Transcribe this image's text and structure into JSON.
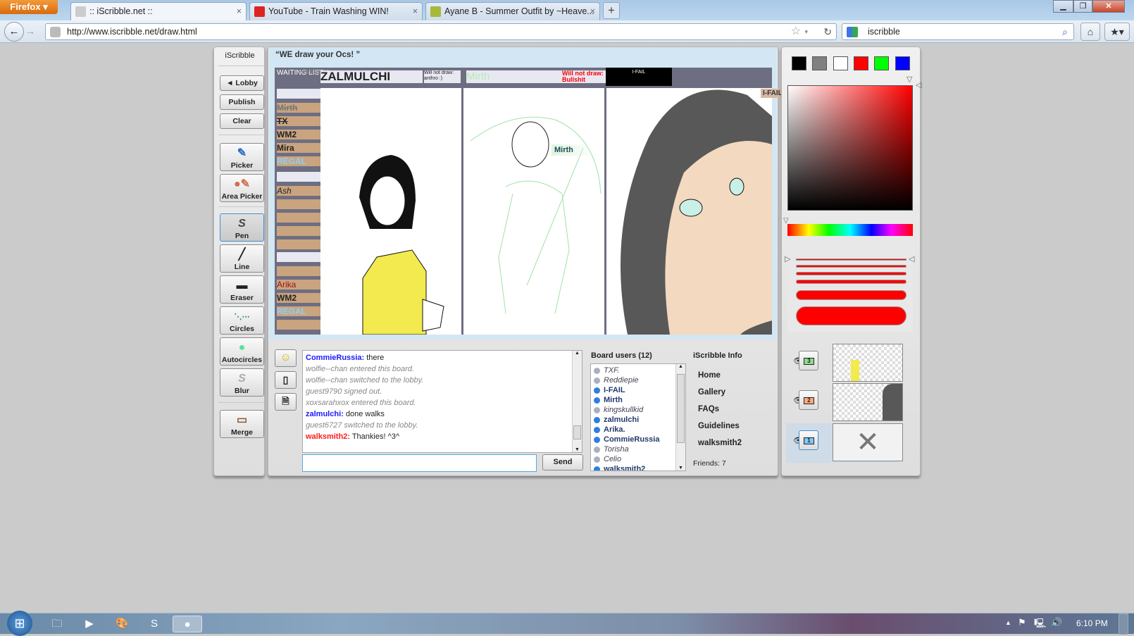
{
  "browser": {
    "menu_button": "Firefox",
    "tabs": [
      {
        "title": ":: iScribble.net ::",
        "active": true
      },
      {
        "title": "YouTube - Train Washing WIN!",
        "active": false
      },
      {
        "title": "Ayane B - Summer Outfit by ~Heave...",
        "active": false
      }
    ],
    "url": "http://www.iscribble.net/draw.html",
    "search_value": "iscribble"
  },
  "toolbar": {
    "brand": "iScribble",
    "lobby": "◄ Lobby",
    "publish": "Publish",
    "clear": "Clear",
    "tools": [
      {
        "label": "Picker",
        "icon": "eyedropper-icon"
      },
      {
        "label": "Area Picker",
        "icon": "area-picker-icon"
      },
      {
        "label": "Pen",
        "icon": "pen-icon",
        "selected": true
      },
      {
        "label": "Line",
        "icon": "line-icon"
      },
      {
        "label": "Eraser",
        "icon": "eraser-icon"
      },
      {
        "label": "Circles",
        "icon": "circles-icon"
      },
      {
        "label": "Autocircles",
        "icon": "autocircles-icon"
      },
      {
        "label": "Blur",
        "icon": "blur-icon"
      },
      {
        "label": "Merge",
        "icon": "merge-icon"
      }
    ]
  },
  "board": {
    "title": "“WE draw your Ocs! ”",
    "canvas": {
      "waiting_list": "WAITING LIST",
      "missing_note": "MISSPINKS",
      "header1": "ZALMULCHI",
      "will_not_draw1": "Will not draw: anthro :)",
      "header2": "Mirth",
      "will_not_draw2": "Will not draw: Bullshit",
      "header3": "I-FAIL",
      "list_entries": [
        "Mirth",
        "TX",
        "WM2",
        "Mira",
        "REGAL",
        "Ash",
        "Arika",
        "WM2",
        "REGAL"
      ],
      "cursor_labels": [
        "Mirth",
        "I-FAIL"
      ]
    }
  },
  "chat": {
    "messages": [
      {
        "user": "CommieRussia:",
        "text": "there",
        "user_color": "#1a1aff"
      },
      {
        "system": "wolfie--chan entered this board."
      },
      {
        "system": "wolfie--chan switched to the lobby."
      },
      {
        "system": "guest9790 signed out."
      },
      {
        "system": "xoxsarahxox entered this board."
      },
      {
        "user": "zalmulchi:",
        "text": "done walks",
        "user_color": "#1a1aff"
      },
      {
        "system": "guest6727 switched to the lobby."
      },
      {
        "user": "walksmith2:",
        "text": "Thankies! ^3^",
        "user_color": "#ff1a1a"
      }
    ],
    "input_value": "",
    "send": "Send"
  },
  "users": {
    "heading": "Board users (12)",
    "list": [
      {
        "name": "TXF.",
        "online": false
      },
      {
        "name": "Reddiepie",
        "online": false
      },
      {
        "name": "I-FAIL",
        "online": true
      },
      {
        "name": "Mirth",
        "online": true
      },
      {
        "name": "kingskullkid",
        "online": false
      },
      {
        "name": "zalmulchi",
        "online": true
      },
      {
        "name": "Arika.",
        "online": true
      },
      {
        "name": "CommieRussia",
        "online": true
      },
      {
        "name": "Torisha",
        "online": false
      },
      {
        "name": "Celio",
        "online": false
      },
      {
        "name": "walksmith2",
        "online": true
      }
    ]
  },
  "info": {
    "heading": "iScribble Info",
    "links": [
      "Home",
      "Gallery",
      "FAQs",
      "Guidelines",
      "walksmith2"
    ],
    "friends": "Friends: 7"
  },
  "palette": {
    "swatches": [
      "#000000",
      "#808080",
      "#ffffff",
      "#ff0000",
      "#00ff00",
      "#0000ff"
    ],
    "current_color": "#ff0000",
    "layers": [
      {
        "number": "3",
        "color": "#8fdc8f",
        "visible": true
      },
      {
        "number": "2",
        "color": "#ffab7a",
        "visible": true
      },
      {
        "number": "1",
        "color": "#7ec8ff",
        "visible": true,
        "selected": true
      }
    ]
  },
  "taskbar": {
    "clock": "6:10 PM"
  }
}
